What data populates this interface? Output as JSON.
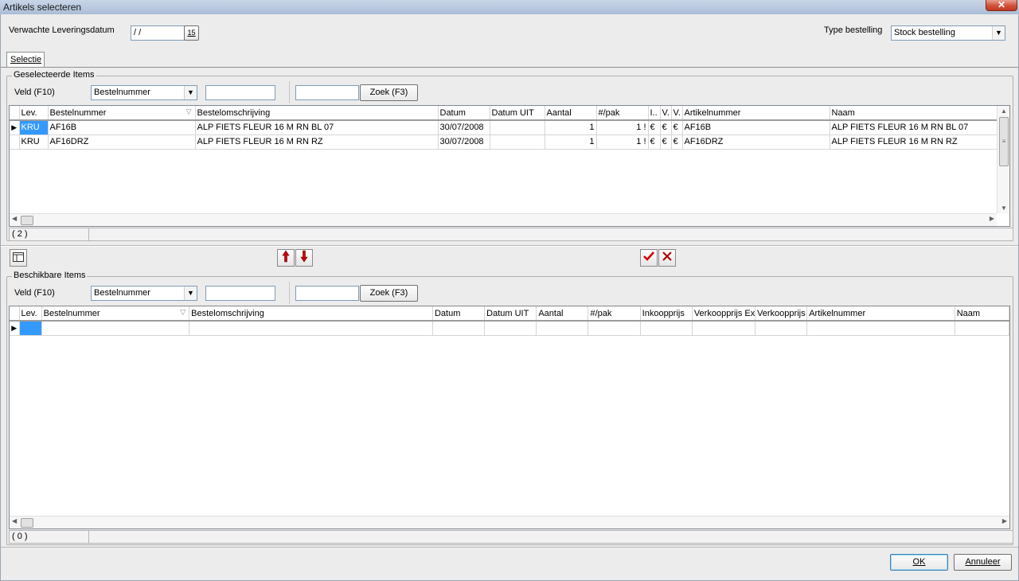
{
  "window": {
    "title": "Artikels selecteren",
    "close_glyph": "✕"
  },
  "header": {
    "delivery_label": "Verwachte Leveringsdatum",
    "delivery_value": " / /",
    "calendar_icon": "calendar-icon",
    "calendar_glyph": "15",
    "order_type_label": "Type bestelling",
    "order_type_value": "Stock bestelling"
  },
  "tabs": [
    {
      "label": "Selectie"
    }
  ],
  "selected_group": {
    "title": "Geselecteerde Items",
    "field_label": "Veld (F10)",
    "field_value": "Bestelnummer",
    "filter_value": "",
    "search_value": "",
    "search_button": "Zoek (F3)",
    "columns": [
      "Lev.",
      "Bestelnummer",
      "Bestelomschrijving",
      "Datum",
      "Datum UIT",
      "Aantal",
      "#/pak",
      "I..",
      "V.",
      "V.",
      "Artikelnummer",
      "Naam"
    ],
    "rows": [
      {
        "lev": "KRU",
        "bestelnummer": "AF16B",
        "omschrijving": "ALP FIETS FLEUR  16 M RN BL 07",
        "datum": "30/07/2008",
        "datum_uit": "",
        "aantal": "1",
        "pak": "1 !",
        "i": "€",
        "v1": "€",
        "v2": "€",
        "artikelnummer": "AF16B",
        "naam": "ALP FIETS FLEUR  16 M RN BL 07"
      },
      {
        "lev": "KRU",
        "bestelnummer": "AF16DRZ",
        "omschrijving": "ALP FIETS FLEUR  16 M RN RZ",
        "datum": "30/07/2008",
        "datum_uit": "",
        "aantal": "1",
        "pak": "1 !",
        "i": "€",
        "v1": "€",
        "v2": "€",
        "artikelnummer": "AF16DRZ",
        "naam": "ALP FIETS FLEUR  16 M RN RZ"
      }
    ],
    "count": "( 2 )"
  },
  "toolbar": {
    "columns_icon": "columns-icon",
    "move_up_icon": "arrow-up-icon",
    "move_down_icon": "arrow-down-icon",
    "confirm_icon": "check-icon",
    "cancel_icon": "cross-icon"
  },
  "available_group": {
    "title": "Beschikbare Items",
    "field_label": "Veld (F10)",
    "field_value": "Bestelnummer",
    "filter_value": "",
    "search_value": "",
    "search_button": "Zoek (F3)",
    "columns": [
      "Lev.",
      "Bestelnummer",
      "Bestelomschrijving",
      "Datum",
      "Datum UIT",
      "Aantal",
      "#/pak",
      "Inkoopprijs",
      "Verkoopprijs Ex",
      "Verkoopprijs",
      "Artikelnummer",
      "Naam"
    ],
    "count": "( 0 )"
  },
  "footer": {
    "ok_button": "OK",
    "cancel_button": "Annuleer"
  },
  "colors": {
    "selection": "#3399ff",
    "arrow_red": "#cc0000",
    "check_red": "#d40000"
  }
}
